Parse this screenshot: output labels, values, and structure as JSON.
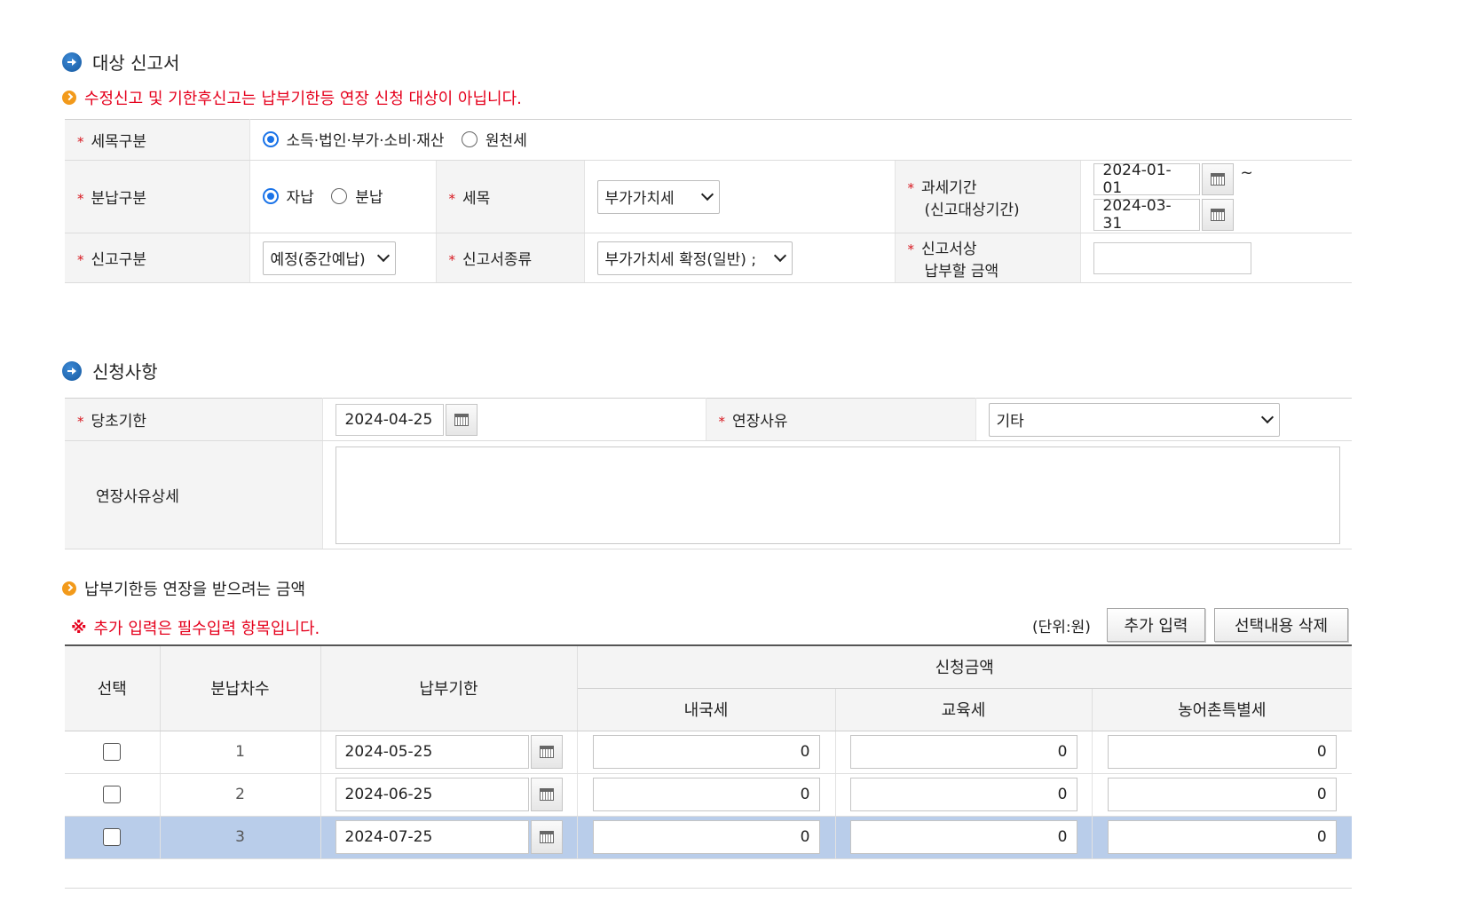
{
  "section1": {
    "title": "대상 신고서",
    "notice": "수정신고 및 기한후신고는 납부기한등 연장 신청 대상이 아닙니다.",
    "tax_category": {
      "label": "세목구분",
      "options": [
        "소득·법인·부가·소비·재산",
        "원천세"
      ],
      "selected": 0
    },
    "payment_type": {
      "label": "분납구분",
      "options": [
        "자납",
        "분납"
      ],
      "selected": 0
    },
    "tax_item": {
      "label": "세목",
      "value": "부가가치세"
    },
    "tax_period": {
      "label_line1": "과세기간",
      "label_line2": "(신고대상기간)",
      "start": "2024-01-01",
      "end": "2024-03-31",
      "separator": "~"
    },
    "report_type": {
      "label": "신고구분",
      "value": "예정(중간예납)"
    },
    "report_kind": {
      "label": "신고서종류",
      "value": "부가가치세 확정(일반) ;"
    },
    "amount_due": {
      "label_line1": "신고서상",
      "label_line2": "납부할 금액",
      "value": ""
    }
  },
  "section2": {
    "title": "신청사항",
    "original_due": {
      "label": "당초기한",
      "value": "2024-04-25"
    },
    "reason": {
      "label": "연장사유",
      "value": "기타"
    },
    "reason_detail": {
      "label": "연장사유상세",
      "value": ""
    }
  },
  "amounts": {
    "title": "납부기한등 연장을 받으려는 금액",
    "required_note": "추가 입력은 필수입력 항목입니다.",
    "required_mark": "※",
    "unit": "(단위:원)",
    "add_button": "추가 입력",
    "delete_button": "선택내용 삭제",
    "headers": {
      "select": "선택",
      "installment": "분납차수",
      "due": "납부기한",
      "request_amount": "신청금액",
      "national_tax": "내국세",
      "education_tax": "교육세",
      "rural_tax": "농어촌특별세"
    },
    "rows": [
      {
        "no": "1",
        "due": "2024-05-25",
        "national": "0",
        "education": "0",
        "rural": "0"
      },
      {
        "no": "2",
        "due": "2024-06-25",
        "national": "0",
        "education": "0",
        "rural": "0"
      },
      {
        "no": "3",
        "due": "2024-07-25",
        "national": "0",
        "education": "0",
        "rural": "0"
      }
    ],
    "highlight_color": "#b9cdea"
  }
}
